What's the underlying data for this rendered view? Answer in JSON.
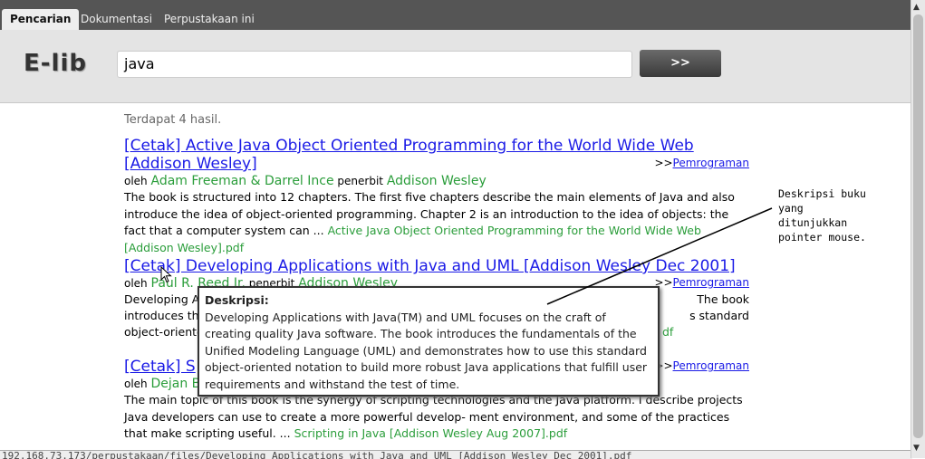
{
  "tabs": [
    {
      "label": "Pencarian"
    },
    {
      "label": "Dokumentasi"
    },
    {
      "label": "Perpustakaan ini"
    }
  ],
  "header": {
    "logo": "E-lib",
    "search_value": "java",
    "search_button": ">>"
  },
  "results_count": "Terdapat 4 hasil.",
  "results": [
    {
      "title": "[Cetak] Active Java Object Oriented Programming for the World Wide Web [Addison Wesley]",
      "category_prefix": ">>",
      "category": "Pemrograman",
      "by": "oleh",
      "authors": "Adam Freeman & Darrel Ince",
      "publisher_label": "penerbit",
      "publisher": "Addison Wesley",
      "description": "The book is structured into 12 chapters. The first five chapters describe the main elements of Java and also introduce the idea of object-oriented programming. Chapter 2 is an introduction to the idea of objects: the fact that a computer system can ...",
      "file": "Active Java Object Oriented Programming for the World Wide Web [Addison Wesley].pdf"
    },
    {
      "title": "[Cetak] Developing Applications with Java and UML [Addison Wesley Dec 2001]",
      "category_prefix": ">>",
      "category": "Pemrograman",
      "by": "oleh",
      "authors": "Paul R. Reed Jr.",
      "publisher_label": "penerbit",
      "publisher": "Addison Wesley",
      "description_visible_left": "Developing Ap",
      "description_visible_right": "The book",
      "line2_left": "introduces the",
      "line2_right": "s standard",
      "line3_left": "object-oriente",
      "line3_right": "df"
    },
    {
      "title": "[Cetak] S",
      "category_prefix": ">>",
      "category": "Pemrograman",
      "by": "oleh",
      "authors": "Dejan Bo",
      "description": "The main topic of this book is the synergy of scripting technologies and the Java platform. I describe projects Java developers can use to create a more powerful develop- ment environment, and some of the practices that make scripting useful.  ...",
      "file": "Scripting in Java [Addison Wesley Aug 2007].pdf"
    }
  ],
  "tooltip": {
    "heading": "Deskripsi:",
    "text": "Developing Applications with Java(TM) and UML focuses on the craft of creating quality Java software. The book introduces the fundamentals of the Unified Modeling Language (UML) and demonstrates how to use this standard object-oriented notation to build more robust Java applications that fulfill user requirements and withstand the test of time."
  },
  "annotation": "Deskripsi buku yang ditunjukkan pointer mouse.",
  "status_url": "192.168.73.173/perpustakaan/files/Developing Applications with Java and UML [Addison Wesley Dec 2001].pdf"
}
